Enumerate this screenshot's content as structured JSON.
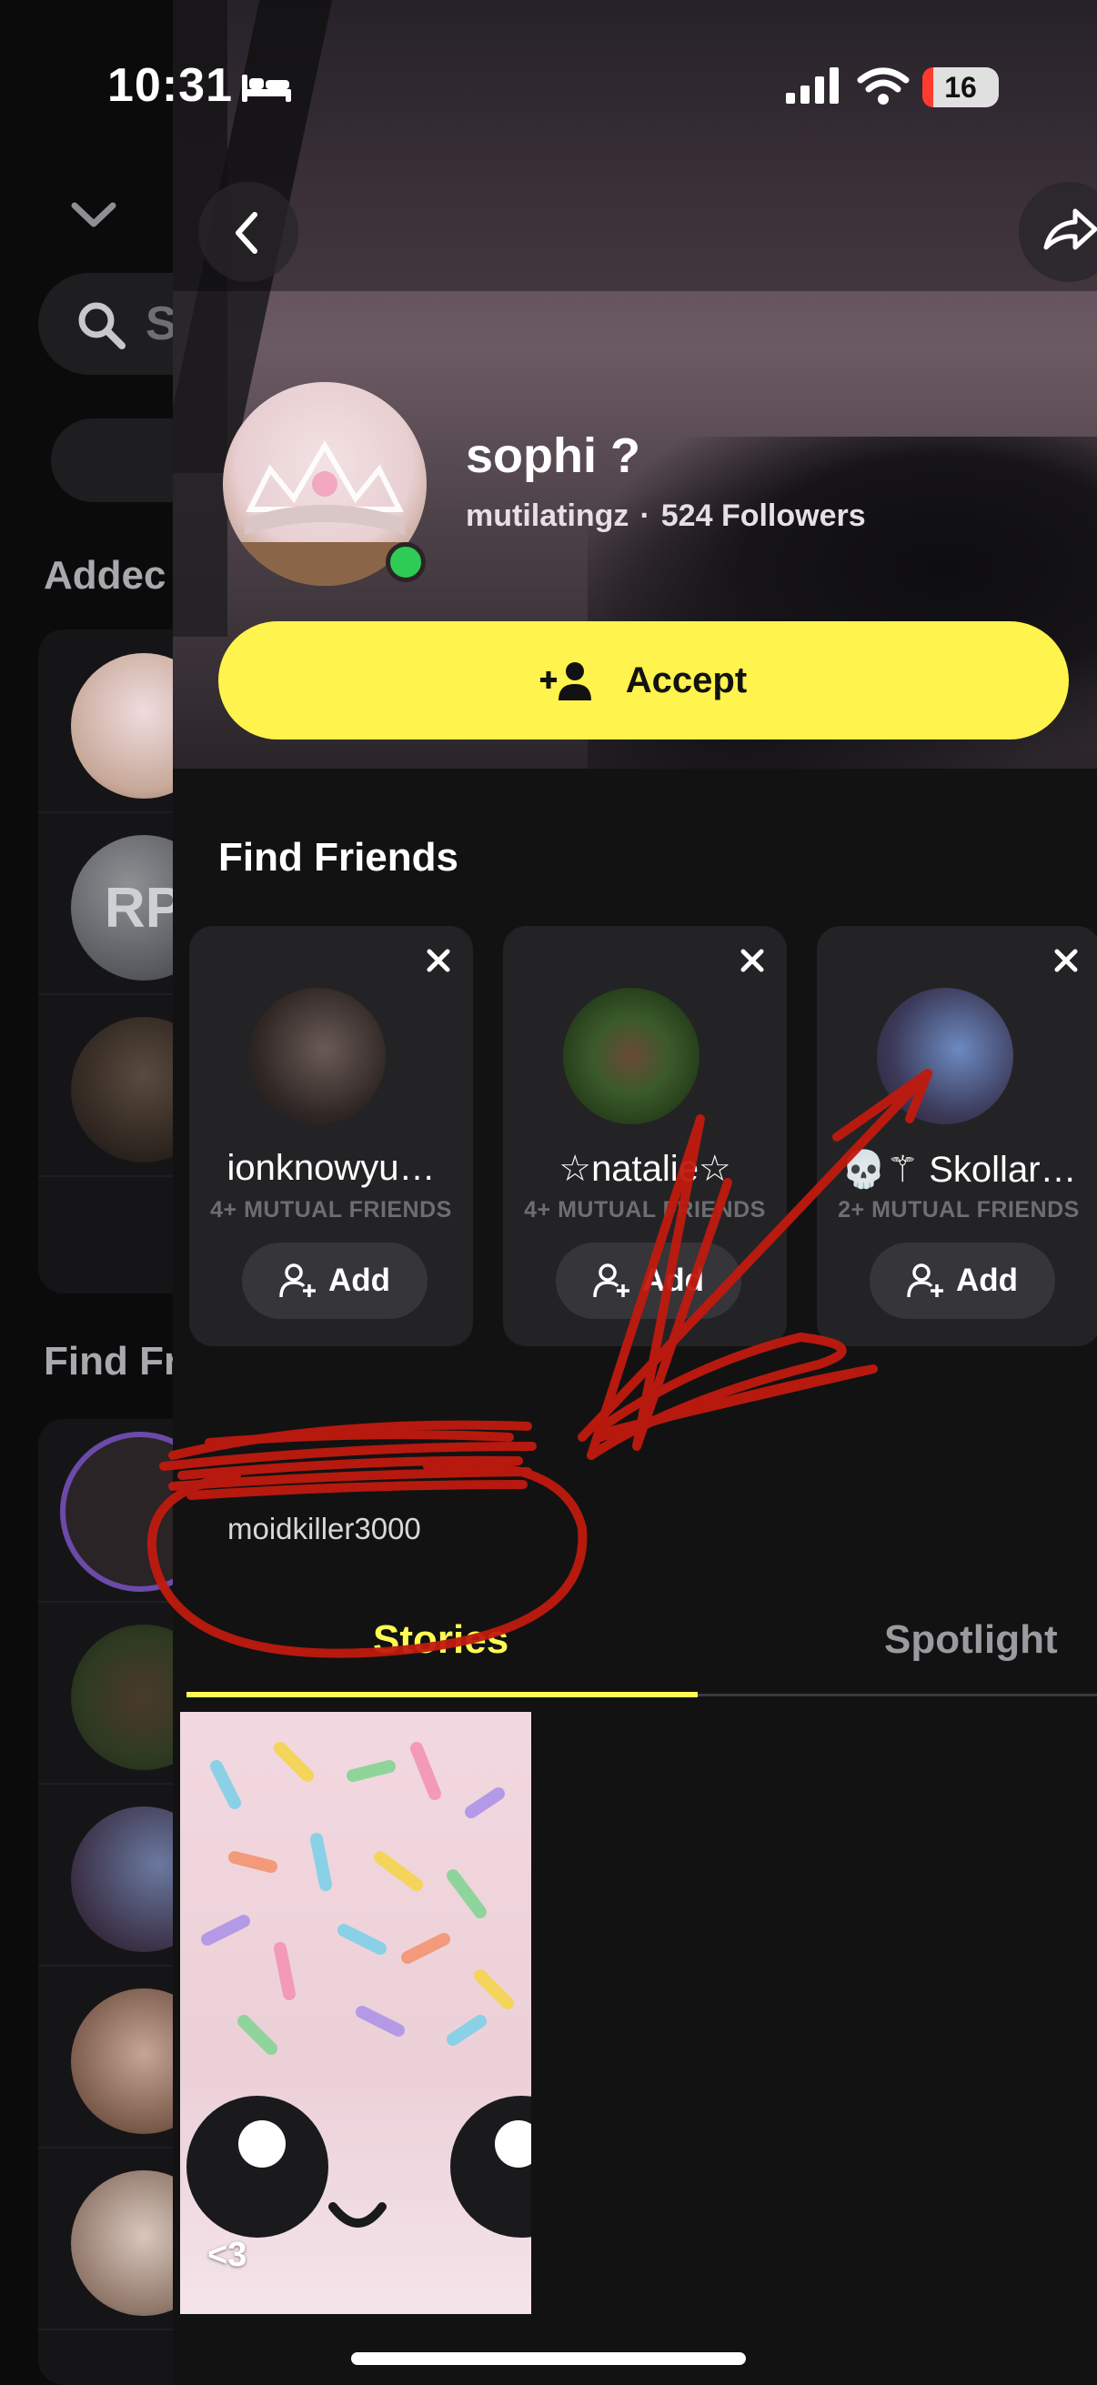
{
  "status_bar": {
    "time": "10:31",
    "battery": "16"
  },
  "background_list": {
    "search_placeholder": "S",
    "section_added": "Addec",
    "section_find": "Find Fr",
    "avatar_initials": "RP"
  },
  "profile": {
    "display_name": "sophi ?",
    "username": "mutilatingz",
    "followers": "524 Followers",
    "separator": "·",
    "accept_label": "Accept"
  },
  "find_friends": {
    "title": "Find Friends",
    "cards": [
      {
        "name": "ionknowyu…",
        "mutual": "4+ MUTUAL FRIENDS",
        "add_label": "Add"
      },
      {
        "name": "☆natalie☆",
        "mutual": "4+ MUTUAL FRIENDS",
        "add_label": "Add"
      },
      {
        "name": "💀⚚ Skollar…",
        "mutual": "2+ MUTUAL FRIENDS",
        "add_label": "Add"
      }
    ]
  },
  "annotation": {
    "username": "moidkiller3000"
  },
  "tabs": {
    "stories": "Stories",
    "spotlight": "Spotlight"
  },
  "story": {
    "caption": "<3"
  },
  "colors": {
    "accent_yellow": "#fffb54",
    "accept_yellow": "#fff34d",
    "online_green": "#2fcc55",
    "scribble_red": "#c01a0e"
  }
}
